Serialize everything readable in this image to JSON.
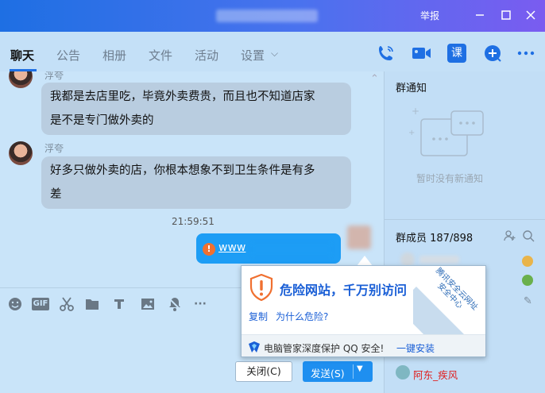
{
  "window": {
    "report_label": "举报",
    "min_icon": "minimize-icon",
    "max_icon": "maximize-icon",
    "close_icon": "close-icon"
  },
  "tabs": [
    {
      "label": "聊天",
      "active": true
    },
    {
      "label": "公告"
    },
    {
      "label": "相册"
    },
    {
      "label": "文件"
    },
    {
      "label": "活动"
    },
    {
      "label": "设置"
    }
  ],
  "tab_settings_chevron": "⌵",
  "header_icons": [
    "phone-icon",
    "video-icon",
    "class-icon",
    "add-icon",
    "more-icon"
  ],
  "header_class_label": "课",
  "messages": [
    {
      "sender": "浮夸",
      "line1": "我都是去店里吃，毕竟外卖费贵，而且也不知道店家",
      "line2": "是不是专门做外卖的"
    },
    {
      "sender": "浮夸",
      "line1": "好多只做外卖的店，你根本想象不到卫生条件是有多",
      "line2": "差"
    }
  ],
  "timestamp": "21:59:51",
  "my_message": {
    "link_text": "www",
    "warning_icon": "warning-icon"
  },
  "toolbar_icons": [
    "emoji-icon",
    "gif-icon",
    "scissors-icon",
    "folder-icon",
    "music-icon",
    "image-icon",
    "bell-off-icon",
    "more-icon"
  ],
  "toolbar": {
    "gif_label": "GIF",
    "more_label": "···"
  },
  "buttons": {
    "close_label": "关闭(C)",
    "send_label": "发送(S)"
  },
  "right_panel": {
    "notice_title": "群通知",
    "no_notice": "暂时没有新通知",
    "members_title": "群成员 187/898",
    "member_name": "阿东_疾风"
  },
  "popup": {
    "title": "危险网站，千万别访问",
    "copy_link": "复制",
    "why_link": "为什么危险?",
    "footer_text": "电脑管家深度保护 QQ 安全!",
    "install_link": "一键安装",
    "corner_text": "腾讯安全云网址安全中心"
  },
  "colors": {
    "accent": "#1e6fe3",
    "send": "#1e8ff0",
    "danger": "#f07030",
    "member_red": "#e02020"
  }
}
